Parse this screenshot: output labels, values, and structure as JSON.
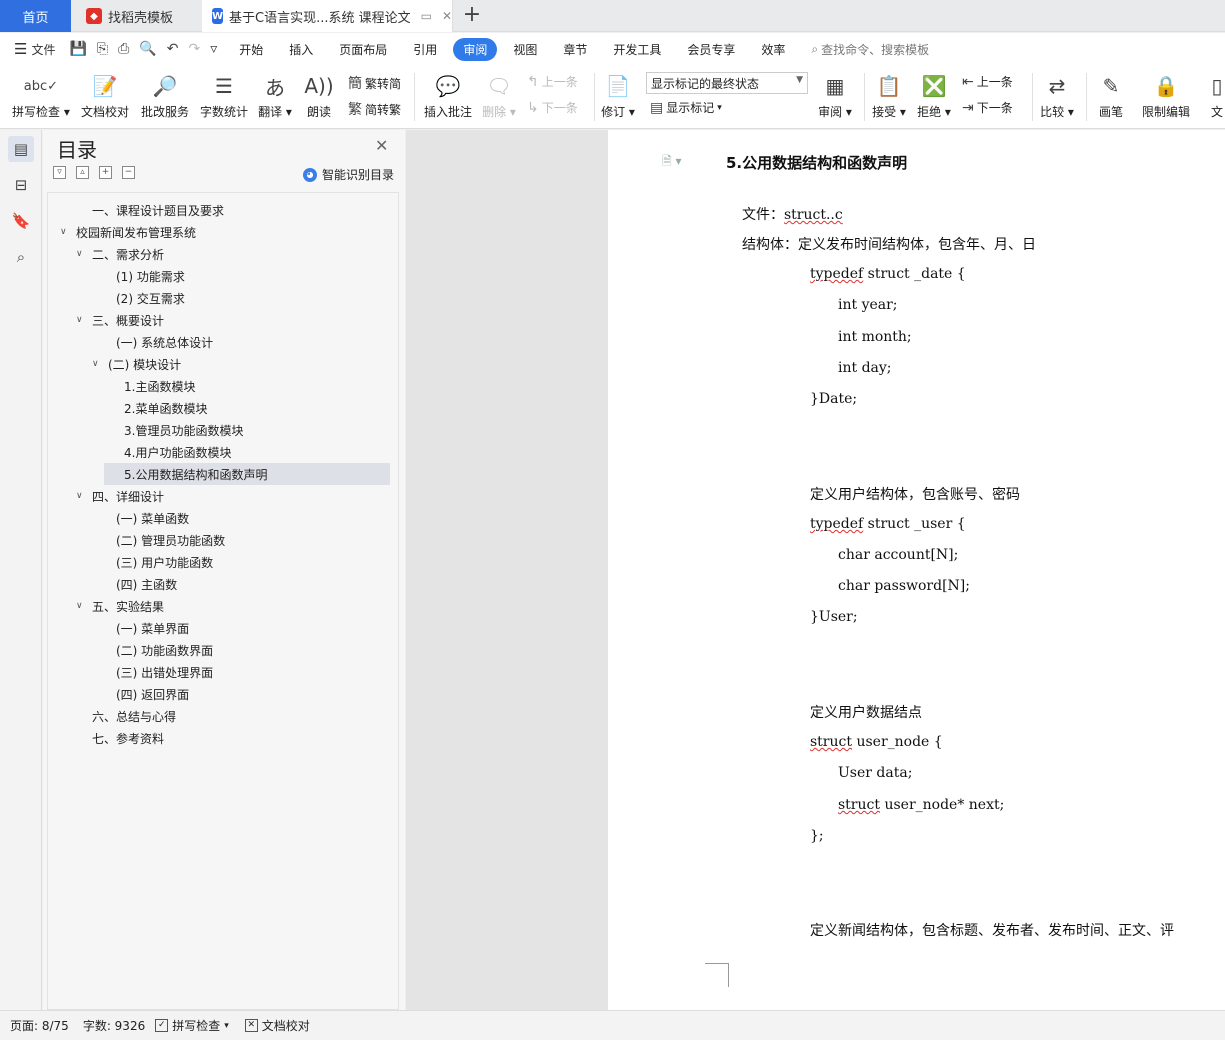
{
  "tabs": {
    "home": "首页",
    "template": "找稻壳模板",
    "document": "基于C语言实现...系统 课程论文",
    "new_tab": "+"
  },
  "menubar": {
    "file": "文件",
    "items": [
      "开始",
      "插入",
      "页面布局",
      "引用",
      "审阅",
      "视图",
      "章节",
      "开发工具",
      "会员专享",
      "效率"
    ],
    "active": "审阅",
    "search_placeholder": "查找命令、搜索模板"
  },
  "ribbon": {
    "spell_check": "拼写检查",
    "doc_proof": "文档校对",
    "revise_service": "批改服务",
    "word_count": "字数统计",
    "translate": "翻译",
    "read_aloud": "朗读",
    "to_traditional": "繁转简",
    "to_simplified": "简转繁",
    "insert_comment": "插入批注",
    "delete": "删除",
    "prev_comment": "上一条",
    "next_comment": "下一条",
    "track_changes": "修订",
    "display_mode": "显示标记的最终状态",
    "show_markup": "显示标记",
    "review": "审阅",
    "accept": "接受",
    "reject": "拒绝",
    "prev_change": "上一条",
    "next_change": "下一条",
    "compare": "比较",
    "pen": "画笔",
    "restrict_edit": "限制编辑",
    "doc_rights": "文"
  },
  "toc": {
    "title": "目录",
    "smart": "智能识别目录",
    "items": [
      {
        "text": "一、课程设计题目及要求"
      },
      {
        "text": "校园新闻发布管理系统"
      },
      {
        "text": "二、需求分析"
      },
      {
        "text": "(1) 功能需求"
      },
      {
        "text": "(2) 交互需求"
      },
      {
        "text": "三、概要设计"
      },
      {
        "text": "(一) 系统总体设计"
      },
      {
        "text": "(二) 模块设计"
      },
      {
        "text": "1.主函数模块"
      },
      {
        "text": "2.菜单函数模块"
      },
      {
        "text": "3.管理员功能函数模块"
      },
      {
        "text": "4.用户功能函数模块"
      },
      {
        "text": "5.公用数据结构和函数声明"
      },
      {
        "text": "四、详细设计"
      },
      {
        "text": "(一) 菜单函数"
      },
      {
        "text": "(二) 管理员功能函数"
      },
      {
        "text": "(三) 用户功能函数"
      },
      {
        "text": "(四) 主函数"
      },
      {
        "text": "五、实验结果"
      },
      {
        "text": "(一) 菜单界面"
      },
      {
        "text": "(二) 功能函数界面"
      },
      {
        "text": "(三) 出错处理界面"
      },
      {
        "text": "(四) 返回界面"
      },
      {
        "text": "六、总结与心得"
      },
      {
        "text": "七、参考资料"
      }
    ]
  },
  "document": {
    "heading": "5.公用数据结构和函数声明",
    "file_label": "文件：",
    "file_name": "struct..c",
    "struct_intro": "结构体：定义发布时间结构体，包含年、月、日",
    "date_kw": "typedef",
    "date_head": "struct _date {",
    "date_year": "int year;",
    "date_month": "int month;",
    "date_day": "int day;",
    "date_close": "}Date;",
    "user_intro": "定义用户结构体，包含账号、密码",
    "user_kw": "typedef",
    "user_head": "struct _user {",
    "user_account": "char account[N];",
    "user_password": "char password[N];",
    "user_close": "}User;",
    "node_intro": "定义用户数据结点",
    "node_kw": "struct",
    "node_head": "user_node {",
    "node_data": "User data;",
    "node_next_kw": "struct",
    "node_next": "user_node* next;",
    "node_close": "};",
    "news_intro": "定义新闻结构体，包含标题、发布者、发布时间、正文、评"
  },
  "status": {
    "page": "页面: 8/75",
    "words": "字数: 9326",
    "spell": "拼写检查",
    "proof": "文档校对"
  },
  "colors": {
    "accent": "#2f7bea",
    "home_tab": "#2f6fe0",
    "spell_underline": "#e03030"
  }
}
